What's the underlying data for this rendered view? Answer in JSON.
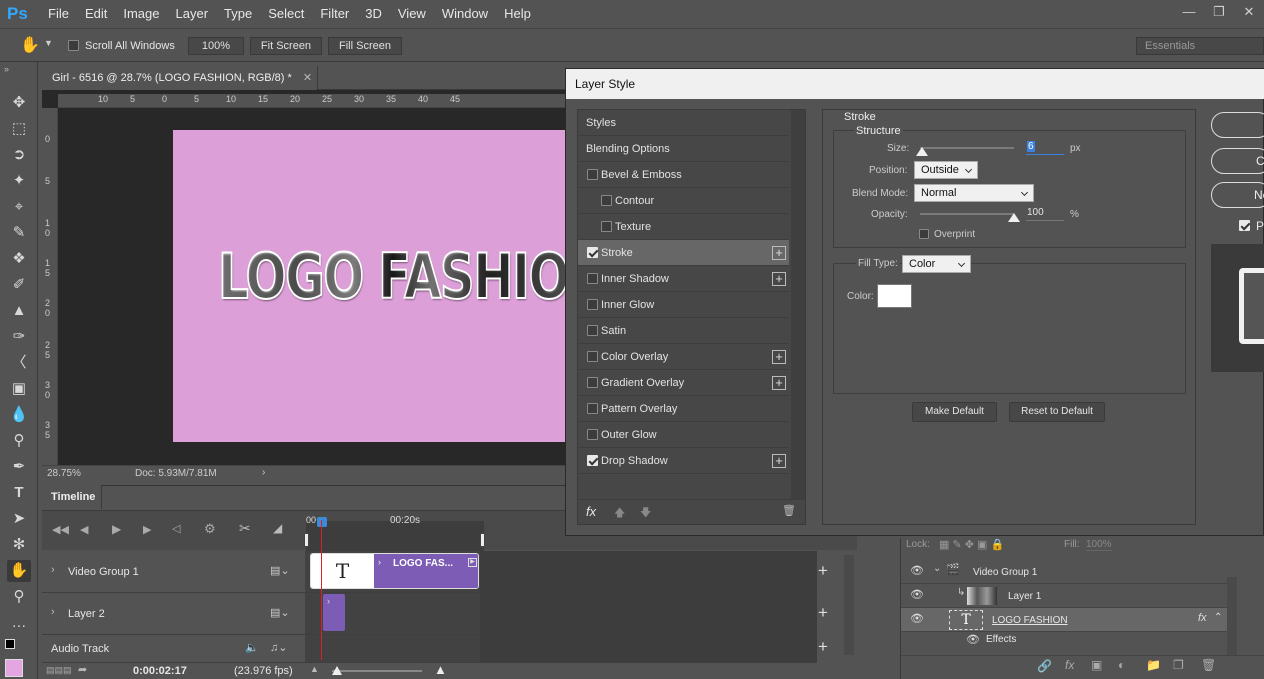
{
  "app": {
    "logo": "Ps"
  },
  "menu": [
    "File",
    "Edit",
    "Image",
    "Layer",
    "Type",
    "Select",
    "Filter",
    "3D",
    "View",
    "Window",
    "Help"
  ],
  "options": {
    "scroll_all_windows": "Scroll All Windows",
    "zoom_btn": "100%",
    "fit_screen": "Fit Screen",
    "fill_screen": "Fill Screen",
    "workspace": "Essentials"
  },
  "document": {
    "tab_title": "Girl - 6516 @ 28.7% (LOGO FASHION, RGB/8) *",
    "canvas_text": "LOGO FASHION",
    "zoom": "28.75%",
    "doc_info": "Doc: 5.93M/7.81M",
    "ruler_top": [
      "10",
      "5",
      "0",
      "5",
      "10",
      "15",
      "20",
      "25",
      "30",
      "35",
      "40",
      "45"
    ],
    "ruler_left": [
      "0",
      "5",
      "1 0",
      "1 5",
      "2 0",
      "2 5",
      "3 0",
      "3 5"
    ]
  },
  "timeline": {
    "tab": "Timeline",
    "time_marker": "00:20s",
    "current_time": "0:00:02:17",
    "fps": "(23.976 fps)",
    "tracks": [
      "Video Group 1",
      "Layer 2",
      "Audio Track"
    ],
    "clip_label": "LOGO FAS..."
  },
  "layers": {
    "lock_label": "Lock:",
    "fill_label": "Fill:",
    "fill_value": "100%",
    "rows": [
      "Video Group 1",
      "Layer 1",
      "LOGO FASHION",
      "Effects"
    ]
  },
  "dialog": {
    "title": "Layer Style",
    "style_items": [
      {
        "label": "Styles",
        "checkbox": false,
        "checked": false,
        "plus": false,
        "indent": 0
      },
      {
        "label": "Blending Options",
        "checkbox": false,
        "checked": false,
        "plus": false,
        "indent": 0
      },
      {
        "label": "Bevel & Emboss",
        "checkbox": true,
        "checked": false,
        "plus": false,
        "indent": 0
      },
      {
        "label": "Contour",
        "checkbox": true,
        "checked": false,
        "plus": false,
        "indent": 1
      },
      {
        "label": "Texture",
        "checkbox": true,
        "checked": false,
        "plus": false,
        "indent": 1
      },
      {
        "label": "Stroke",
        "checkbox": true,
        "checked": true,
        "plus": true,
        "indent": 0
      },
      {
        "label": "Inner Shadow",
        "checkbox": true,
        "checked": false,
        "plus": true,
        "indent": 0
      },
      {
        "label": "Inner Glow",
        "checkbox": true,
        "checked": false,
        "plus": false,
        "indent": 0
      },
      {
        "label": "Satin",
        "checkbox": true,
        "checked": false,
        "plus": false,
        "indent": 0
      },
      {
        "label": "Color Overlay",
        "checkbox": true,
        "checked": false,
        "plus": true,
        "indent": 0
      },
      {
        "label": "Gradient Overlay",
        "checkbox": true,
        "checked": false,
        "plus": true,
        "indent": 0
      },
      {
        "label": "Pattern Overlay",
        "checkbox": true,
        "checked": false,
        "plus": false,
        "indent": 0
      },
      {
        "label": "Outer Glow",
        "checkbox": true,
        "checked": false,
        "plus": false,
        "indent": 0
      },
      {
        "label": "Drop Shadow",
        "checkbox": true,
        "checked": true,
        "plus": true,
        "indent": 0
      }
    ],
    "fx_label": "fx",
    "stroke": {
      "section": "Stroke",
      "structure": "Structure",
      "size_label": "Size:",
      "size_value": "6",
      "size_unit": "px",
      "size_level": 0.02,
      "position_label": "Position:",
      "position_value": "Outside",
      "blend_label": "Blend Mode:",
      "blend_value": "Normal",
      "opacity_label": "Opacity:",
      "opacity_value": "100",
      "opacity_unit": "%",
      "opacity_level": 1.0,
      "overprint": "Overprint",
      "fill_type_label": "Fill Type:",
      "fill_type_value": "Color",
      "color_label": "Color:",
      "color_value": "#ffffff",
      "make_default": "Make Default",
      "reset_default": "Reset to Default"
    },
    "right_buttons": [
      "C",
      "New"
    ],
    "preview_label": "P"
  },
  "colors": {
    "accent": "#31a8ff",
    "canvas_bg": "#dd9fd8",
    "clip": "#7d5cb5",
    "playhead": "#e02020",
    "foreground": "#e4a6e0"
  }
}
